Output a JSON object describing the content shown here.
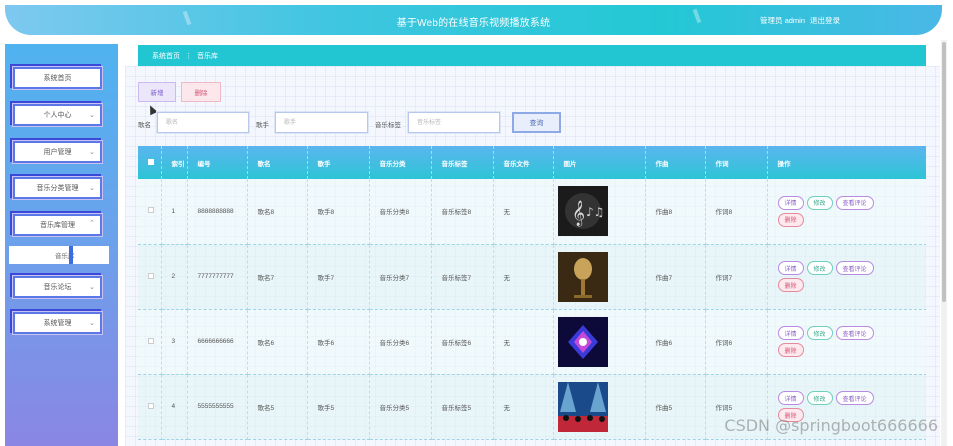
{
  "header": {
    "title": "基于Web的在线音乐视频播放系统",
    "user": "管理员 admin",
    "logout": "退出登录"
  },
  "sidebar": {
    "items": [
      {
        "label": "系统首页",
        "has_arrow": false
      },
      {
        "label": "个人中心",
        "has_arrow": true
      },
      {
        "label": "用户管理",
        "has_arrow": true
      },
      {
        "label": "音乐分类管理",
        "has_arrow": true
      },
      {
        "label": "音乐库管理",
        "has_arrow": true,
        "expanded": true
      },
      {
        "label": "音乐论坛",
        "has_arrow": true
      },
      {
        "label": "系统管理",
        "has_arrow": true
      }
    ],
    "submenu": "音乐库"
  },
  "breadcrumb": {
    "home": "系统首页",
    "separator": "⋮",
    "current": "音乐库"
  },
  "toolbar": {
    "add": "新增",
    "delete": "删除"
  },
  "search": {
    "name_label": "歌名",
    "name_placeholder": "歌名",
    "singer_label": "歌手",
    "singer_placeholder": "歌手",
    "tag_label": "音乐标签",
    "tag_placeholder": "音乐标签",
    "query": "查询"
  },
  "table": {
    "headers": [
      "",
      "索引",
      "编号",
      "歌名",
      "歌手",
      "音乐分类",
      "音乐标签",
      "音乐文件",
      "图片",
      "作曲",
      "作词",
      "操作"
    ],
    "rows": [
      {
        "index": "1",
        "code": "8888888888",
        "name": "歌名8",
        "singer": "歌手8",
        "category": "音乐分类8",
        "tag": "音乐标签8",
        "file": "无",
        "image": "music-notes",
        "composer": "作曲8",
        "lyricist": "作词8"
      },
      {
        "index": "2",
        "code": "7777777777",
        "name": "歌名7",
        "singer": "歌手7",
        "category": "音乐分类7",
        "tag": "音乐标签7",
        "file": "无",
        "image": "microphone",
        "composer": "作曲7",
        "lyricist": "作词7"
      },
      {
        "index": "3",
        "code": "6666666666",
        "name": "歌名6",
        "singer": "歌手6",
        "category": "音乐分类6",
        "tag": "音乐标签6",
        "file": "无",
        "image": "stage-lights",
        "composer": "作曲6",
        "lyricist": "作词6"
      },
      {
        "index": "4",
        "code": "5555555555",
        "name": "歌名5",
        "singer": "歌手5",
        "category": "音乐分类5",
        "tag": "音乐标签5",
        "file": "无",
        "image": "concert-crowd",
        "composer": "作曲5",
        "lyricist": "作词5"
      }
    ],
    "actions": {
      "detail": "详情",
      "edit": "修改",
      "comments": "查看评论",
      "delete": "删除"
    }
  },
  "watermark": "CSDN @springboot666666",
  "colors": {
    "accent": "#22c6d2",
    "sidebar_top": "#4fb3ef",
    "sidebar_bottom": "#8a86e4",
    "header_text": "#ffffff"
  }
}
